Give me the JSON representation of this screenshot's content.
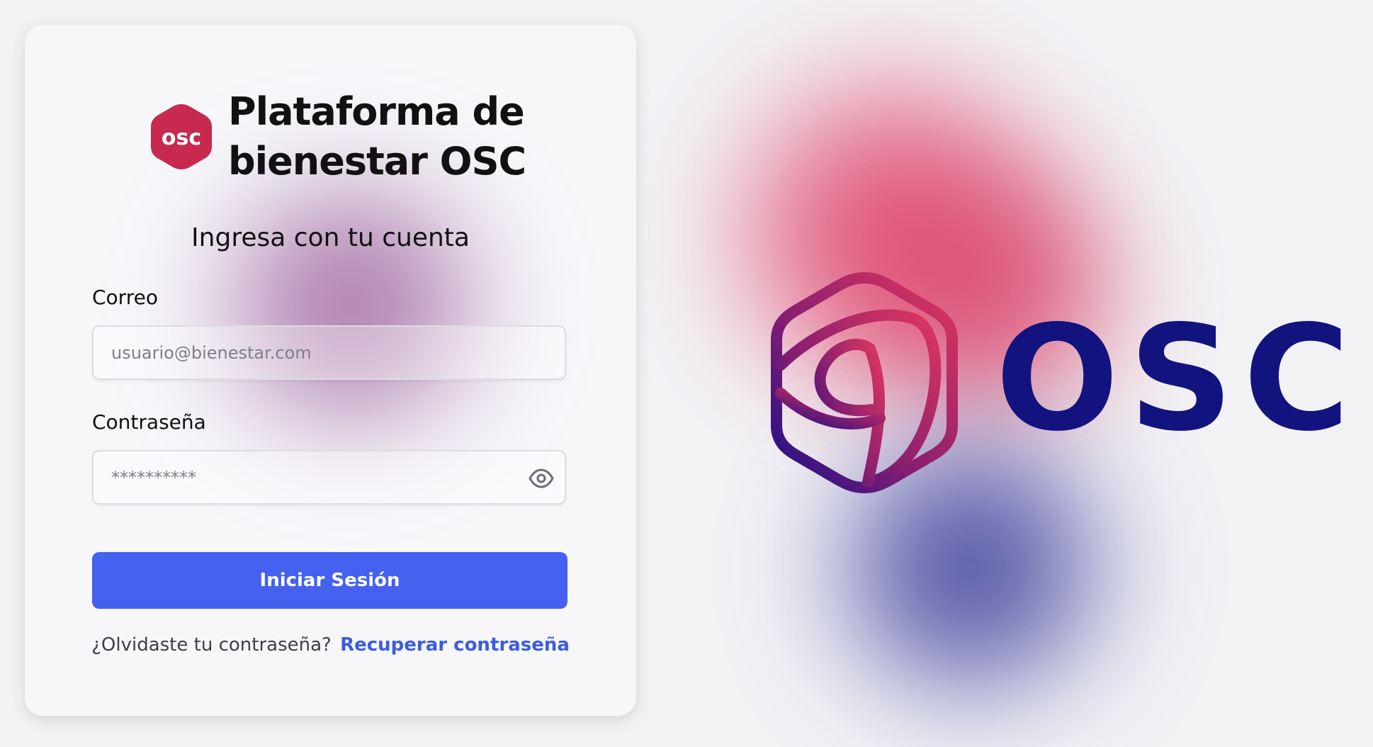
{
  "brand": {
    "badge_text": "osc",
    "title": "Plataforma de bienestar OSC",
    "badge_color": "#c8294f"
  },
  "login": {
    "heading": "Ingresa con tu cuenta",
    "email_label": "Correo",
    "email_placeholder": "usuario@bienestar.com",
    "password_label": "Contraseña",
    "password_placeholder": "**********",
    "password_toggle_icon": "eye-icon",
    "submit_label": "Iniciar Sesión",
    "forgot_text": "¿Olvidaste tu contraseña?",
    "recover_link": "Recuperar contraseña"
  },
  "hero": {
    "wordmark": "OSC",
    "wordmark_color": "#13137f",
    "logo_gradient": [
      "#e0365f",
      "#1b0f8a"
    ]
  },
  "colors": {
    "primary_button": "#4461ef",
    "link": "#3c5ce0",
    "background": "#f2f2f5"
  }
}
